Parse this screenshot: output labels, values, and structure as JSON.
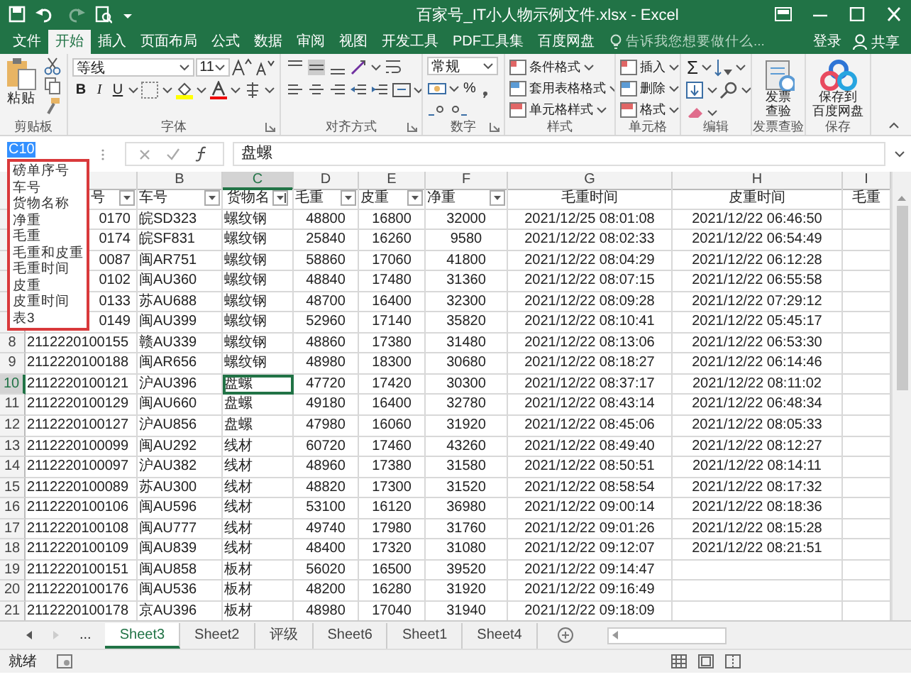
{
  "title_bar": {
    "title": "百家号_IT小人物示例文件.xlsx - Excel"
  },
  "ribbon_tabs": [
    {
      "label": "文件",
      "selected": false
    },
    {
      "label": "开始",
      "selected": true
    },
    {
      "label": "插入",
      "selected": false
    },
    {
      "label": "页面布局",
      "selected": false
    },
    {
      "label": "公式",
      "selected": false
    },
    {
      "label": "数据",
      "selected": false
    },
    {
      "label": "审阅",
      "selected": false
    },
    {
      "label": "视图",
      "selected": false
    },
    {
      "label": "开发工具",
      "selected": false
    },
    {
      "label": "PDF工具集",
      "selected": false
    },
    {
      "label": "百度网盘",
      "selected": false
    }
  ],
  "tell_me": {
    "placeholder": "告诉我您想要做什么..."
  },
  "account": {
    "sign_in": "登录",
    "share": "共享"
  },
  "ribbon": [
    {
      "kind": "clipboard",
      "label": "剪贴板",
      "paste": "粘贴"
    },
    {
      "kind": "font",
      "label": "字体",
      "font_name": "等线",
      "font_size": "11",
      "bold": "B",
      "italic": "I",
      "underline": "U"
    },
    {
      "kind": "alignment",
      "label": "对齐方式"
    },
    {
      "kind": "number",
      "label": "数字",
      "format": "常规",
      "percent": "%"
    },
    {
      "kind": "list",
      "label": "样式",
      "items": [
        "条件格式",
        "套用表格格式",
        "单元格样式"
      ]
    },
    {
      "kind": "list",
      "label": "单元格",
      "items": [
        "插入",
        "删除",
        "格式"
      ]
    },
    {
      "kind": "editing",
      "label": "编辑",
      "sum": "Σ"
    },
    {
      "kind": "invoice",
      "label": "发票查验",
      "button": [
        "发票",
        "查验"
      ]
    },
    {
      "kind": "cloud",
      "label": "保存",
      "button": [
        "保存到",
        "百度网盘"
      ]
    }
  ],
  "formula_bar": {
    "name_box": "C10",
    "value": "盘螺"
  },
  "name_list": {
    "expanded": true,
    "items": [
      "磅单序号",
      "车号",
      "货物名称",
      "净重",
      "毛重",
      "毛重和皮重",
      "毛重时间",
      "皮重",
      "皮重时间",
      "表3"
    ]
  },
  "columns": [
    {
      "selected": false
    },
    {
      "label": "B",
      "selected": false
    },
    {
      "label": "C",
      "selected": true
    },
    {
      "label": "D",
      "selected": false
    },
    {
      "label": "E",
      "selected": false
    },
    {
      "label": "F",
      "selected": false
    },
    {
      "label": "G",
      "selected": false
    },
    {
      "label": "H",
      "selected": false
    },
    {
      "label": "I",
      "selected": false
    }
  ],
  "header_row": [
    {
      "text": "号",
      "filter": true
    },
    {
      "text": "车号",
      "filter": true
    },
    {
      "text": "货物名",
      "filter": true
    },
    {
      "text": "毛重",
      "filter": true
    },
    {
      "text": "皮重",
      "filter": true
    },
    {
      "text": "净重",
      "filter": true
    },
    {
      "text": "毛重时间",
      "filter": false
    },
    {
      "text": "皮重时间",
      "filter": false
    },
    {
      "text": "毛重",
      "filter": false
    }
  ],
  "rows": [
    {
      "partly_hidden": true,
      "cells": [
        "0170",
        "皖SD323",
        "螺纹钢",
        "48800",
        "16800",
        "32000",
        "2021/12/25 08:01:08",
        "2021/12/22 06:46:50"
      ]
    },
    {
      "partly_hidden": true,
      "cells": [
        "0174",
        "皖SF831",
        "螺纹钢",
        "25840",
        "16260",
        "9580",
        "2021/12/22 08:02:33",
        "2021/12/22 06:54:49"
      ]
    },
    {
      "partly_hidden": true,
      "cells": [
        "0087",
        "闽AR751",
        "螺纹钢",
        "58860",
        "17060",
        "41800",
        "2021/12/22 08:04:29",
        "2021/12/22 06:12:28"
      ]
    },
    {
      "partly_hidden": true,
      "cells": [
        "0102",
        "闽AU360",
        "螺纹钢",
        "48840",
        "17480",
        "31360",
        "2021/12/22 08:07:15",
        "2021/12/22 06:55:58"
      ]
    },
    {
      "partly_hidden": true,
      "cells": [
        "0133",
        "苏AU688",
        "螺纹钢",
        "48700",
        "16400",
        "32300",
        "2021/12/22 08:09:28",
        "2021/12/22 07:29:12"
      ]
    },
    {
      "partly_hidden": true,
      "cells": [
        "0149",
        "闽AU399",
        "螺纹钢",
        "52960",
        "17140",
        "35820",
        "2021/12/22 08:10:41",
        "2021/12/22 05:45:17"
      ]
    },
    {
      "number": "8",
      "selected": false,
      "partly_hidden": false,
      "cells": [
        "2112220100155",
        "赣AU339",
        "螺纹钢",
        "48860",
        "17380",
        "31480",
        "2021/12/22 08:13:06",
        "2021/12/22 06:53:30"
      ]
    },
    {
      "number": "9",
      "selected": false,
      "partly_hidden": false,
      "cells": [
        "2112220100188",
        "闽AR656",
        "螺纹钢",
        "48980",
        "18300",
        "30680",
        "2021/12/22 08:18:27",
        "2021/12/22 06:14:46"
      ]
    },
    {
      "number": "10",
      "selected": true,
      "partly_hidden": false,
      "cells": [
        "2112220100121",
        "沪AU396",
        "盘螺",
        "47720",
        "17420",
        "30300",
        "2021/12/22 08:37:17",
        "2021/12/22 08:11:02"
      ]
    },
    {
      "number": "11",
      "selected": false,
      "partly_hidden": false,
      "cells": [
        "2112220100129",
        "闽AU660",
        "盘螺",
        "49180",
        "16400",
        "32780",
        "2021/12/22 08:43:14",
        "2021/12/22 06:48:34"
      ]
    },
    {
      "number": "12",
      "selected": false,
      "partly_hidden": false,
      "cells": [
        "2112220100127",
        "沪AU856",
        "盘螺",
        "47980",
        "16060",
        "31920",
        "2021/12/22 08:45:06",
        "2021/12/22 08:05:33"
      ]
    },
    {
      "number": "13",
      "selected": false,
      "partly_hidden": false,
      "cells": [
        "2112220100099",
        "闽AU292",
        "线材",
        "60720",
        "17460",
        "43260",
        "2021/12/22 08:49:40",
        "2021/12/22 08:12:27"
      ]
    },
    {
      "number": "14",
      "selected": false,
      "partly_hidden": false,
      "cells": [
        "2112220100097",
        "沪AU382",
        "线材",
        "48960",
        "17380",
        "31580",
        "2021/12/22 08:50:51",
        "2021/12/22 08:14:11"
      ]
    },
    {
      "number": "15",
      "selected": false,
      "partly_hidden": false,
      "cells": [
        "2112220100089",
        "苏AU300",
        "线材",
        "48820",
        "17300",
        "31520",
        "2021/12/22 08:58:54",
        "2021/12/22 08:17:32"
      ]
    },
    {
      "number": "16",
      "selected": false,
      "partly_hidden": false,
      "cells": [
        "2112220100106",
        "闽AU596",
        "线材",
        "53100",
        "16120",
        "36980",
        "2021/12/22 09:00:14",
        "2021/12/22 08:18:36"
      ]
    },
    {
      "number": "17",
      "selected": false,
      "partly_hidden": false,
      "cells": [
        "2112220100108",
        "闽AU777",
        "线材",
        "49740",
        "17980",
        "31760",
        "2021/12/22 09:01:26",
        "2021/12/22 08:15:28"
      ]
    },
    {
      "number": "18",
      "selected": false,
      "partly_hidden": false,
      "cells": [
        "2112220100109",
        "闽AU839",
        "线材",
        "48400",
        "17320",
        "31080",
        "2021/12/22 09:12:07",
        "2021/12/22 08:21:51"
      ]
    },
    {
      "number": "19",
      "selected": false,
      "partly_hidden": false,
      "cells": [
        "2112220100151",
        "闽AU858",
        "板材",
        "56020",
        "16500",
        "39520",
        "2021/12/22 09:14:47"
      ]
    },
    {
      "number": "20",
      "selected": false,
      "partly_hidden": false,
      "cells": [
        "2112220100176",
        "闽AU536",
        "板材",
        "48200",
        "16280",
        "31920",
        "2021/12/22 09:16:49"
      ]
    },
    {
      "number": "21",
      "selected": false,
      "partly_hidden": false,
      "cells": [
        "2112220100178",
        "京AU396",
        "板材",
        "48980",
        "17040",
        "31940",
        "2021/12/22 09:18:09"
      ]
    }
  ],
  "sheet_nav": {
    "more": "..."
  },
  "sheet_tabs": [
    {
      "label": "Sheet3",
      "selected": true
    },
    {
      "label": "Sheet2",
      "selected": false
    },
    {
      "label": "评级",
      "selected": false
    },
    {
      "label": "Sheet6",
      "selected": false
    },
    {
      "label": "Sheet1",
      "selected": false
    },
    {
      "label": "Sheet4",
      "selected": false
    }
  ],
  "status_bar": {
    "status": "就绪"
  }
}
